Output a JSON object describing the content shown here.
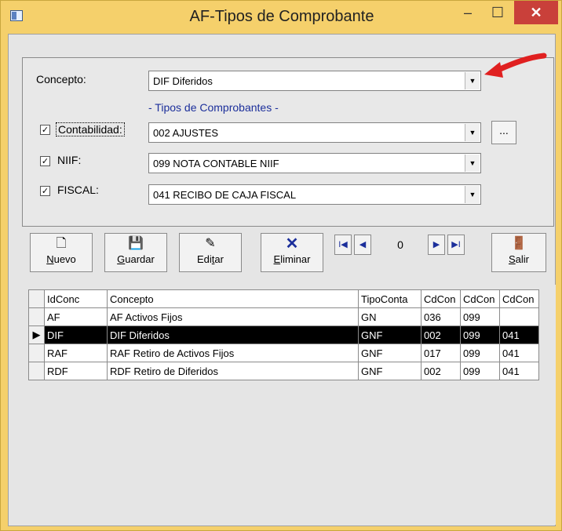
{
  "window": {
    "title": "AF-Tipos de Comprobante",
    "min_glyph": "–",
    "max_glyph": "☐",
    "close_glyph": "✕"
  },
  "form": {
    "concepto_label": "Concepto:",
    "concepto_value": "DIF Diferidos",
    "tipos_header": "- Tipos de Comprobantes -",
    "contabilidad": {
      "label": "Contabilidad:",
      "checked": true,
      "value": "002  AJUSTES"
    },
    "niif": {
      "label": "NIIF:",
      "checked": true,
      "value": "099 NOTA CONTABLE NIIF"
    },
    "fiscal": {
      "label": "FISCAL:",
      "checked": true,
      "value": "041 RECIBO DE CAJA FISCAL"
    },
    "browse_label": "...",
    "check_glyph": "✓"
  },
  "toolbar": {
    "nuevo": {
      "label_u": "N",
      "label_rest": "uevo",
      "icon": "new-document-icon"
    },
    "guardar": {
      "label_u": "G",
      "label_rest": "uardar",
      "icon": "floppy-disk-icon"
    },
    "editar": {
      "label_pre": "Edi",
      "label_u": "t",
      "label_rest": "ar",
      "icon": "edit-pencil-icon"
    },
    "eliminar": {
      "label_u": "E",
      "label_rest": "liminar",
      "icon": "delete-x-icon"
    },
    "salir": {
      "label_u": "S",
      "label_rest": "alir",
      "icon": "exit-door-icon"
    }
  },
  "navigator": {
    "first": "I◀",
    "prev": "◀",
    "position": "0",
    "next": "▶",
    "last": "▶I"
  },
  "grid": {
    "columns": [
      "IdConc",
      "Concepto",
      "TipoConta",
      "CdCon",
      "CdCon",
      "CdCon"
    ],
    "rows": [
      {
        "id": "AF",
        "concepto": "AF Activos Fijos",
        "tipo": "GN",
        "c1": "036",
        "c2": "099",
        "c3": "",
        "selected": false
      },
      {
        "id": "DIF",
        "concepto": "DIF Diferidos",
        "tipo": "GNF",
        "c1": "002",
        "c2": "099",
        "c3": "041",
        "selected": true
      },
      {
        "id": "RAF",
        "concepto": "RAF Retiro de Activos Fijos",
        "tipo": "GNF",
        "c1": "017",
        "c2": "099",
        "c3": "041",
        "selected": false
      },
      {
        "id": "RDF",
        "concepto": "RDF Retiro de Diferidos",
        "tipo": "GNF",
        "c1": "002",
        "c2": "099",
        "c3": "041",
        "selected": false
      }
    ],
    "row_pointer": "▶"
  },
  "colors": {
    "title_bar": "#f5d06b",
    "close": "#c9403a",
    "selection": "#000000",
    "accent_text": "#1c2f9b",
    "callout_arrow": "#e02020"
  }
}
